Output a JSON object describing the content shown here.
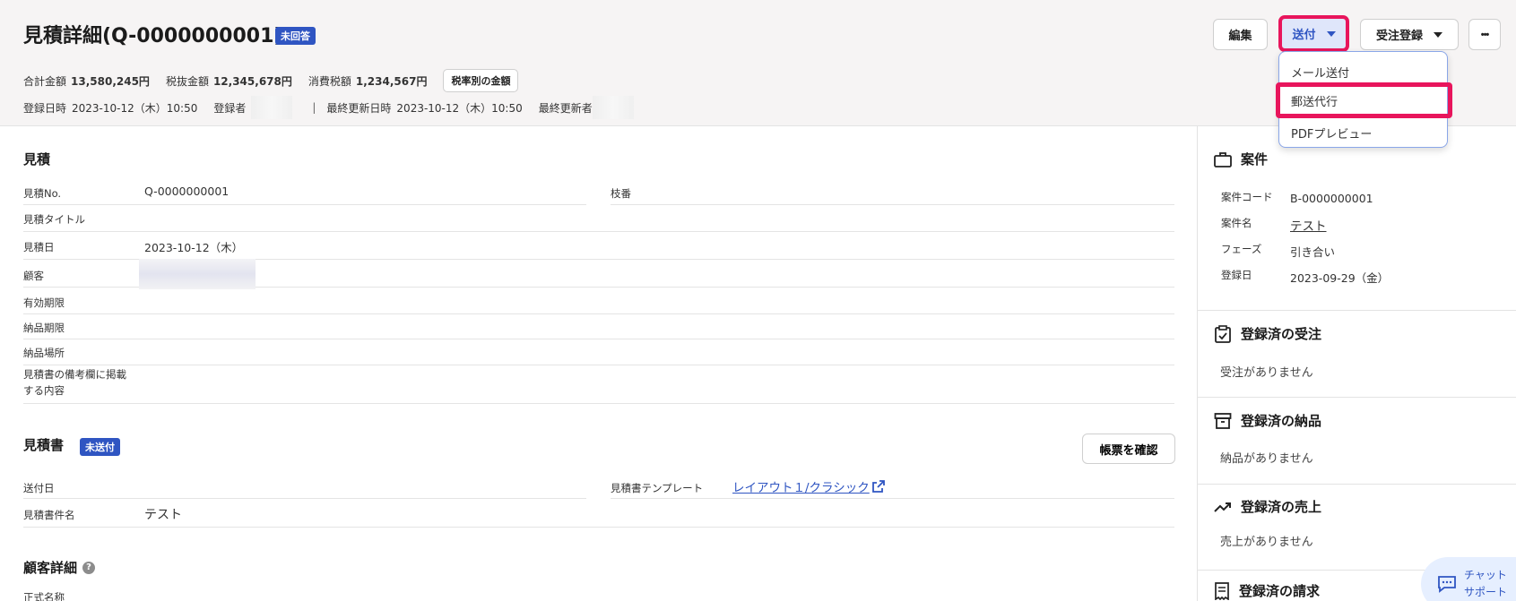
{
  "header": {
    "title": "見積詳細(Q-0000000001)",
    "status_badge": "未回答",
    "total_label": "合計金額",
    "total_value": "13,580,245円",
    "pretax_label": "税抜金額",
    "pretax_value": "12,345,678円",
    "tax_label": "消費税額",
    "tax_value": "1,234,567円",
    "tax_rate_button": "税率別の金額",
    "created_label": "登録日時",
    "created_value": "2023-10-12（木）10:50",
    "creator_label": "登録者",
    "separator": "|",
    "updated_label": "最終更新日時",
    "updated_value": "2023-10-12（木）10:50",
    "updater_label": "最終更新者"
  },
  "toolbar": {
    "edit_label": "編集",
    "send_label": "送付",
    "order_label": "受注登録",
    "more_label": "•••"
  },
  "send_menu": {
    "items": [
      "メール送付",
      "郵送代行",
      "PDFプレビュー"
    ]
  },
  "estimate": {
    "title": "見積",
    "no_label": "見積No.",
    "no_value": "Q-0000000001",
    "branch_label": "枝番",
    "title_label": "見積タイトル",
    "date_label": "見積日",
    "date_value": "2023-10-12（木）",
    "customer_label": "顧客",
    "expiry_label": "有効期限",
    "delivery_deadline_label": "納品期限",
    "delivery_place_label": "納品場所",
    "remarks_label_1": "見積書の備考欄に掲載",
    "remarks_label_2": "する内容"
  },
  "document": {
    "title": "見積書",
    "status_badge": "未送付",
    "check_button": "帳票を確認",
    "sent_date_label": "送付日",
    "template_label": "見積書テンプレート",
    "template_value": "レイアウト１/クラシック",
    "name_label": "見積書件名",
    "name_value": "テスト"
  },
  "customer_detail": {
    "title": "顧客詳細",
    "official_name_label": "正式名称"
  },
  "sidebar": {
    "project": {
      "title": "案件",
      "code_label": "案件コード",
      "code_value": "B-0000000001",
      "name_label": "案件名",
      "name_value": "テスト",
      "phase_label": "フェーズ",
      "phase_value": "引き合い",
      "date_label": "登録日",
      "date_value": "2023-09-29（金）"
    },
    "orders": {
      "title": "登録済の受注",
      "empty": "受注がありません"
    },
    "deliveries": {
      "title": "登録済の納品",
      "empty": "納品がありません"
    },
    "sales": {
      "title": "登録済の売上",
      "empty": "売上がありません"
    },
    "invoices": {
      "title": "登録済の請求"
    }
  },
  "chat": {
    "line1": "チャット",
    "line2": "サポート"
  },
  "colors": {
    "accent": "#2f55c2",
    "highlight": "#e8155c"
  }
}
